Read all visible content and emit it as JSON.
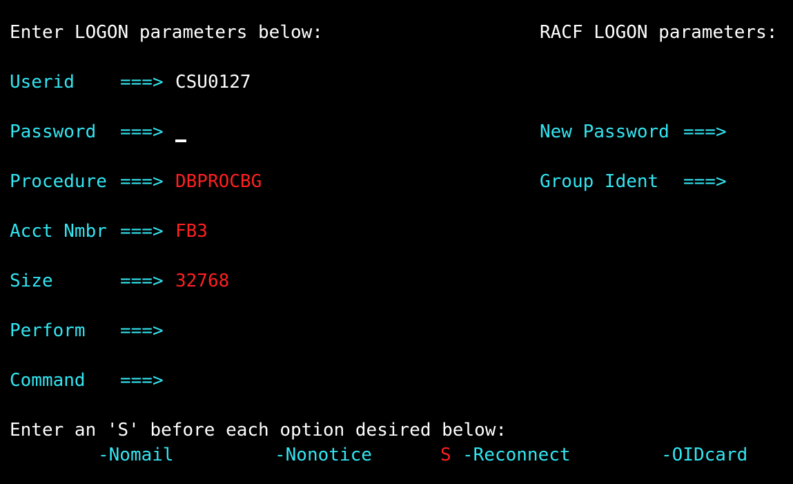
{
  "header": {
    "left_title": "Enter LOGON parameters below:",
    "right_title": "RACF LOGON parameters:"
  },
  "fields": {
    "userid": {
      "label": "Userid",
      "arrow": "===>",
      "value": "CSU0127"
    },
    "password": {
      "label": "Password",
      "arrow": "===>",
      "value": ""
    },
    "procedure": {
      "label": "Procedure",
      "arrow": "===>",
      "value": "DBPROCBG"
    },
    "acct_nmbr": {
      "label": "Acct Nmbr",
      "arrow": "===>",
      "value": "FB3"
    },
    "size": {
      "label": "Size",
      "arrow": "===>",
      "value": "32768"
    },
    "perform": {
      "label": "Perform",
      "arrow": "===>",
      "value": ""
    },
    "command": {
      "label": "Command",
      "arrow": "===>",
      "value": ""
    }
  },
  "racf": {
    "new_password": {
      "label": "New Password",
      "arrow": "===>",
      "value": ""
    },
    "group_ident": {
      "label": "Group Ident",
      "arrow": "===>",
      "value": ""
    }
  },
  "options": {
    "instruction": "Enter an 'S' before each option desired below:",
    "nomail": {
      "mark": "",
      "label": "-Nomail"
    },
    "nonotice": {
      "mark": "",
      "label": "-Nonotice"
    },
    "reconnect": {
      "mark": "S",
      "label": "-Reconnect"
    },
    "oidcard": {
      "mark": "",
      "label": "-OIDcard"
    }
  },
  "colors": {
    "background": "#000000",
    "label": "#33e6f2",
    "text": "#ffffff",
    "input": "#ff2020"
  }
}
